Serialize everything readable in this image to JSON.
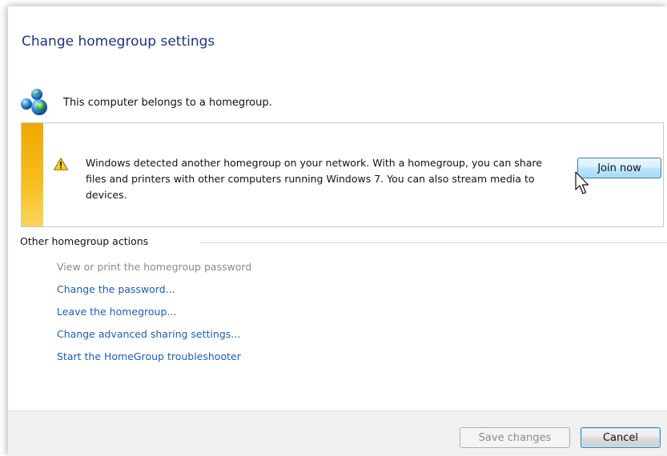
{
  "page": {
    "title": "Change homegroup settings"
  },
  "status": {
    "icon": "homegroup-icon",
    "text": "This computer belongs to a homegroup."
  },
  "notice": {
    "icon": "warning-icon",
    "message": "Windows detected another homegroup on your network. With a homegroup, you can share files and printers with other computers running Windows 7. You can also stream media to devices.",
    "button_label": "Join now",
    "accent_color": "#f6bd1e"
  },
  "actions": {
    "heading": "Other homegroup actions",
    "items": [
      {
        "label": "View or print the homegroup password",
        "enabled": false
      },
      {
        "label": "Change the password...",
        "enabled": true
      },
      {
        "label": "Leave the homegroup...",
        "enabled": true
      },
      {
        "label": "Change advanced sharing settings...",
        "enabled": true
      },
      {
        "label": "Start the HomeGroup troubleshooter",
        "enabled": true
      }
    ]
  },
  "footer": {
    "save_label": "Save changes",
    "cancel_label": "Cancel"
  },
  "colors": {
    "title": "#1e3287",
    "link": "#1e5bbf",
    "disabled_link": "#8a8a8a"
  }
}
